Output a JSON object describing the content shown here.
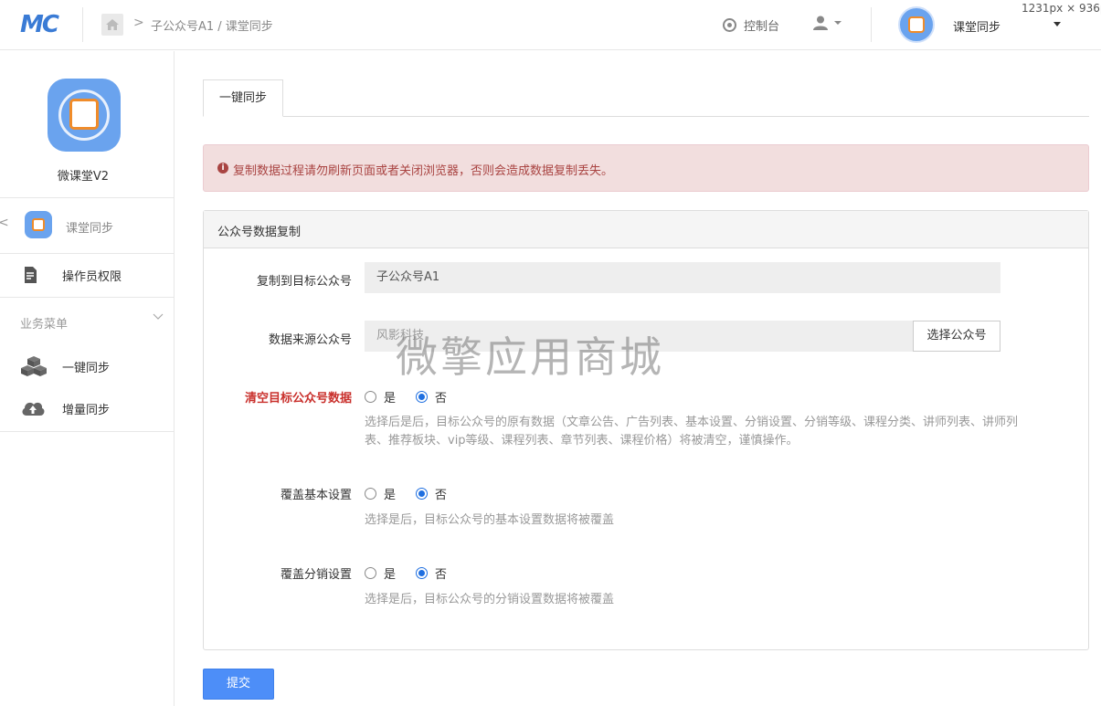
{
  "header": {
    "logo": "MC",
    "breadcrumb": "子公众号A1 / 课堂同步",
    "console_label": "控制台",
    "app_name": "课堂同步",
    "size_hint": "1231px × 936p"
  },
  "sidebar": {
    "app_name": "微课堂V2",
    "current_item": "课堂同步",
    "permission_item": "操作员权限",
    "menu_title": "业务菜单",
    "items": [
      {
        "label": "一键同步",
        "icon": "cubes-icon"
      },
      {
        "label": "增量同步",
        "icon": "cloud-upload-icon"
      }
    ]
  },
  "main": {
    "tab_label": "一键同步",
    "alert_text": "复制数据过程请勿刷新页面或者关闭浏览器，否则会造成数据复制丢失。",
    "panel_title": "公众号数据复制",
    "form": {
      "target": {
        "label": "复制到目标公众号",
        "value": "子公众号A1"
      },
      "source": {
        "label": "数据来源公众号",
        "value": "风影科技",
        "button": "选择公众号"
      },
      "clear": {
        "label": "清空目标公众号数据",
        "yes": "是",
        "no": "否",
        "selected": "否",
        "help": "选择后是后，目标公众号的原有数据（文章公告、广告列表、基本设置、分销设置、分销等级、课程分类、讲师列表、讲师列表、推荐板块、vip等级、课程列表、章节列表、课程价格）将被清空，谨慎操作。"
      },
      "basic": {
        "label": "覆盖基本设置",
        "yes": "是",
        "no": "否",
        "selected": "否",
        "help": "选择是后，目标公众号的基本设置数据将被覆盖"
      },
      "dist": {
        "label": "覆盖分销设置",
        "yes": "是",
        "no": "否",
        "selected": "否",
        "help": "选择是后，目标公众号的分销设置数据将被覆盖"
      }
    },
    "submit_label": "提交",
    "watermark": "微擎应用商城"
  }
}
